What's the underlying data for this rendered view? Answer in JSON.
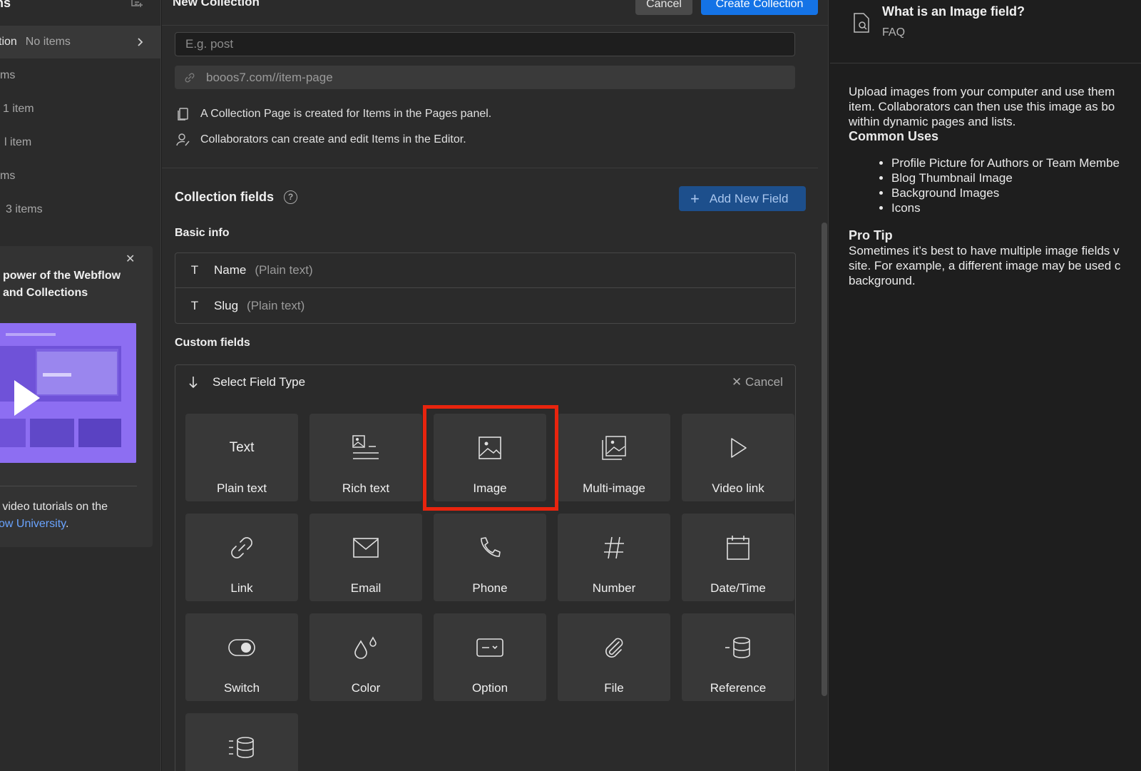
{
  "sidebar": {
    "title": "ns",
    "rows": [
      {
        "name": "tion",
        "count": "No items",
        "active": true
      },
      {
        "name": "",
        "count": "ms"
      },
      {
        "name": "",
        "count": "1 item"
      },
      {
        "name": "",
        "count": "l item"
      },
      {
        "name": "",
        "count": "ms"
      },
      {
        "name": "",
        "count": "3 items"
      }
    ],
    "promo": {
      "close": "✕",
      "title": "power of the Webflow and Collections",
      "text_prefix": "e video tutorials on the",
      "link": "flow University",
      "text_suffix": "."
    }
  },
  "main": {
    "title": "New Collection",
    "cancel_label": "Cancel",
    "create_label": "Create Collection",
    "singular_placeholder": "E.g. post",
    "slug_text": "booos7.com//item-page",
    "info_page": "A Collection Page is created for Items in the Pages panel.",
    "info_editor": "Collaborators can create and edit Items in the Editor.",
    "collection_fields": "Collection fields",
    "help": "?",
    "add_field_label": "Add New Field",
    "basic_info": "Basic info",
    "basic_fields": [
      {
        "icon": "T",
        "name": "Name",
        "type": "(Plain text)"
      },
      {
        "icon": "T",
        "name": "Slug",
        "type": "(Plain text)"
      }
    ],
    "custom_fields": "Custom fields",
    "select_field_type": "Select Field Type",
    "cancel_select": "✕  Cancel",
    "field_types": [
      {
        "label": "Plain text",
        "icon": "text-icon",
        "icon_text": "Text"
      },
      {
        "label": "Rich text",
        "icon": "rich-text-icon"
      },
      {
        "label": "Image",
        "icon": "image-icon",
        "selected": true
      },
      {
        "label": "Multi-image",
        "icon": "multi-image-icon"
      },
      {
        "label": "Video link",
        "icon": "play-icon"
      },
      {
        "label": "Link",
        "icon": "link-icon"
      },
      {
        "label": "Email",
        "icon": "email-icon"
      },
      {
        "label": "Phone",
        "icon": "phone-icon"
      },
      {
        "label": "Number",
        "icon": "hash-icon"
      },
      {
        "label": "Date/Time",
        "icon": "calendar-icon"
      },
      {
        "label": "Switch",
        "icon": "switch-icon"
      },
      {
        "label": "Color",
        "icon": "color-drops-icon"
      },
      {
        "label": "Option",
        "icon": "option-icon"
      },
      {
        "label": "File",
        "icon": "paperclip-icon"
      },
      {
        "label": "Reference",
        "icon": "reference-icon"
      },
      {
        "label": "",
        "icon": "multi-reference-icon"
      }
    ],
    "highlight_color": "#e8240e"
  },
  "right_panel": {
    "title": "What is an Image field?",
    "subtitle": "FAQ",
    "intro_1": "Upload images from your computer and use them",
    "intro_2": "item. Collaborators can then use this image as bo",
    "intro_3": "within dynamic pages and lists.",
    "common_uses_heading": "Common Uses",
    "common_uses": [
      "Profile Picture for Authors or Team Membe",
      "Blog Thumbnail Image",
      "Background Images",
      "Icons"
    ],
    "pro_tip_heading": "Pro Tip",
    "pro_tip_1": "Sometimes it’s best to have multiple image fields v",
    "pro_tip_2": "site. For example, a different image may be used c",
    "pro_tip_3": "background."
  },
  "colors": {
    "accent_blue": "#1473e6",
    "panel_bg": "#2b2b2b",
    "tile_bg": "#383838",
    "highlight": "#e8240e"
  }
}
